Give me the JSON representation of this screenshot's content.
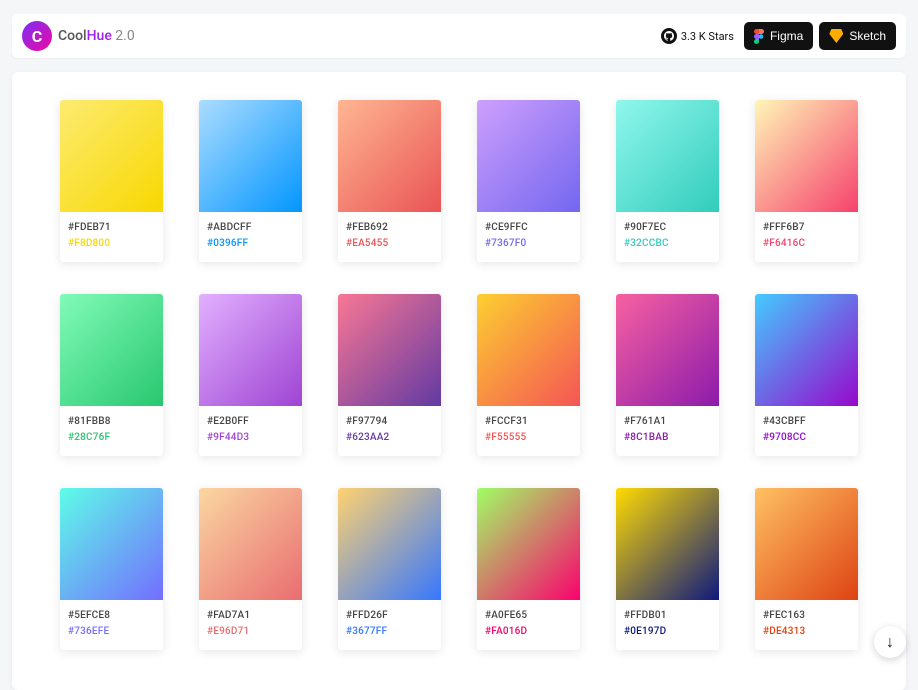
{
  "header": {
    "brand_cool": "Cool",
    "brand_hue": "Hue",
    "brand_ver": " 2.0",
    "github_stars": "3.3 K Stars",
    "figma_label": "Figma",
    "sketch_label": "Sketch"
  },
  "fab_glyph": "↓",
  "swatches": [
    {
      "from": "#FDEB71",
      "to": "#F8D800",
      "toColor": "#F8D800"
    },
    {
      "from": "#ABDCFF",
      "to": "#0396FF",
      "toColor": "#0396FF"
    },
    {
      "from": "#FEB692",
      "to": "#EA5455",
      "toColor": "#EA5455"
    },
    {
      "from": "#CE9FFC",
      "to": "#7367F0",
      "toColor": "#7367F0"
    },
    {
      "from": "#90F7EC",
      "to": "#32CCBC",
      "toColor": "#32CCBC"
    },
    {
      "from": "#FFF6B7",
      "to": "#F6416C",
      "toColor": "#F6416C"
    },
    {
      "from": "#81FBB8",
      "to": "#28C76F",
      "toColor": "#28C76F"
    },
    {
      "from": "#E2B0FF",
      "to": "#9F44D3",
      "toColor": "#9F44D3"
    },
    {
      "from": "#F97794",
      "to": "#623AA2",
      "toColor": "#623AA2"
    },
    {
      "from": "#FCCF31",
      "to": "#F55555",
      "toColor": "#F55555"
    },
    {
      "from": "#F761A1",
      "to": "#8C1BAB",
      "toColor": "#8C1BAB"
    },
    {
      "from": "#43CBFF",
      "to": "#9708CC",
      "toColor": "#9708CC"
    },
    {
      "from": "#5EFCE8",
      "to": "#736EFE",
      "toColor": "#736EFE"
    },
    {
      "from": "#FAD7A1",
      "to": "#E96D71",
      "toColor": "#E96D71"
    },
    {
      "from": "#FFD26F",
      "to": "#3677FF",
      "toColor": "#3677FF"
    },
    {
      "from": "#A0FE65",
      "to": "#FA016D",
      "toColor": "#FA016D"
    },
    {
      "from": "#FFDB01",
      "to": "#0E197D",
      "toColor": "#0E197D"
    },
    {
      "from": "#FEC163",
      "to": "#DE4313",
      "toColor": "#DE4313"
    }
  ]
}
